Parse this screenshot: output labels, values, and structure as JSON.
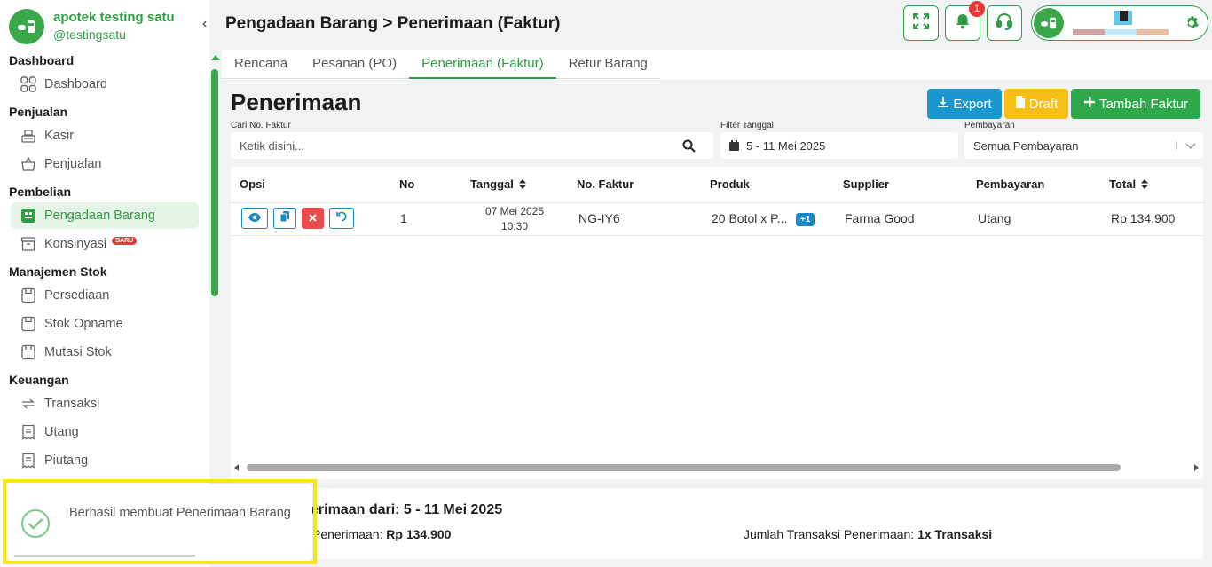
{
  "sidebar": {
    "brand_name": "apotek testing satu",
    "brand_handle": "@testingsatu",
    "collapse_glyph": "‹",
    "sections": [
      {
        "title": "Dashboard",
        "items": [
          {
            "label": "Dashboard",
            "icon": "dashboard-grid-icon"
          }
        ]
      },
      {
        "title": "Penjualan",
        "items": [
          {
            "label": "Kasir",
            "icon": "cash-register-icon"
          },
          {
            "label": "Penjualan",
            "icon": "basket-icon"
          }
        ]
      },
      {
        "title": "Pembelian",
        "items": [
          {
            "label": "Pengadaan Barang",
            "icon": "procurement-icon",
            "active": true
          },
          {
            "label": "Konsinyasi",
            "icon": "archive-box-icon",
            "badge": "BARU"
          }
        ]
      },
      {
        "title": "Manajemen Stok",
        "items": [
          {
            "label": "Persediaan",
            "icon": "inventory-icon"
          },
          {
            "label": "Stok Opname",
            "icon": "stock-opname-icon"
          },
          {
            "label": "Mutasi Stok",
            "icon": "stock-mutation-icon"
          }
        ]
      },
      {
        "title": "Keuangan",
        "items": [
          {
            "label": "Transaksi",
            "icon": "transaction-icon"
          },
          {
            "label": "Utang",
            "icon": "receipt-icon"
          },
          {
            "label": "Piutang",
            "icon": "receipt-icon"
          }
        ]
      }
    ]
  },
  "header": {
    "title": "Pengadaan Barang > Penerimaan (Faktur)",
    "notification_count": "1"
  },
  "tabs": [
    {
      "label": "Rencana",
      "active": false
    },
    {
      "label": "Pesanan (PO)",
      "active": false
    },
    {
      "label": "Penerimaan (Faktur)",
      "active": true
    },
    {
      "label": "Retur Barang",
      "active": false
    }
  ],
  "page": {
    "title": "Penerimaan",
    "buttons": {
      "export": "Export",
      "draft": "Draft",
      "add": "Tambah Faktur"
    }
  },
  "filters": {
    "search_label": "Cari No. Faktur",
    "search_placeholder": "Ketik disini...",
    "date_label": "Filter Tanggal",
    "date_value": "5 - 11 Mei 2025",
    "payment_label": "Pembayaran",
    "payment_value": "Semua Pembayaran"
  },
  "table": {
    "headers": {
      "opsi": "Opsi",
      "no": "No",
      "tanggal": "Tanggal",
      "faktur": "No. Faktur",
      "produk": "Produk",
      "supplier": "Supplier",
      "pembayaran": "Pembayaran",
      "total": "Total"
    },
    "rows": [
      {
        "no": "1",
        "tanggal_date": "07 Mei 2025",
        "tanggal_time": "10:30",
        "faktur": "NG-IY6",
        "produk": "20 Botol x P...",
        "produk_extra": "+1",
        "supplier": "Farma Good",
        "pembayaran": "Utang",
        "total": "Rp 134.900"
      }
    ]
  },
  "summary": {
    "title": "erimaan dari: 5 - 11 Mei 2025",
    "total_label": "Penerimaan:",
    "total_value": "Rp 134.900",
    "count_label": "Jumlah Transaksi Penerimaan:",
    "count_value": "1x Transaksi"
  },
  "toast": {
    "message": "Berhasil membuat Penerimaan Barang"
  },
  "colors": {
    "primary_green": "#2e9d44",
    "export_blue": "#1a97cf",
    "draft_yellow": "#f7be16",
    "add_green": "#2ea84a",
    "danger_red": "#e84c4c",
    "highlight_yellow": "#f5e614"
  }
}
